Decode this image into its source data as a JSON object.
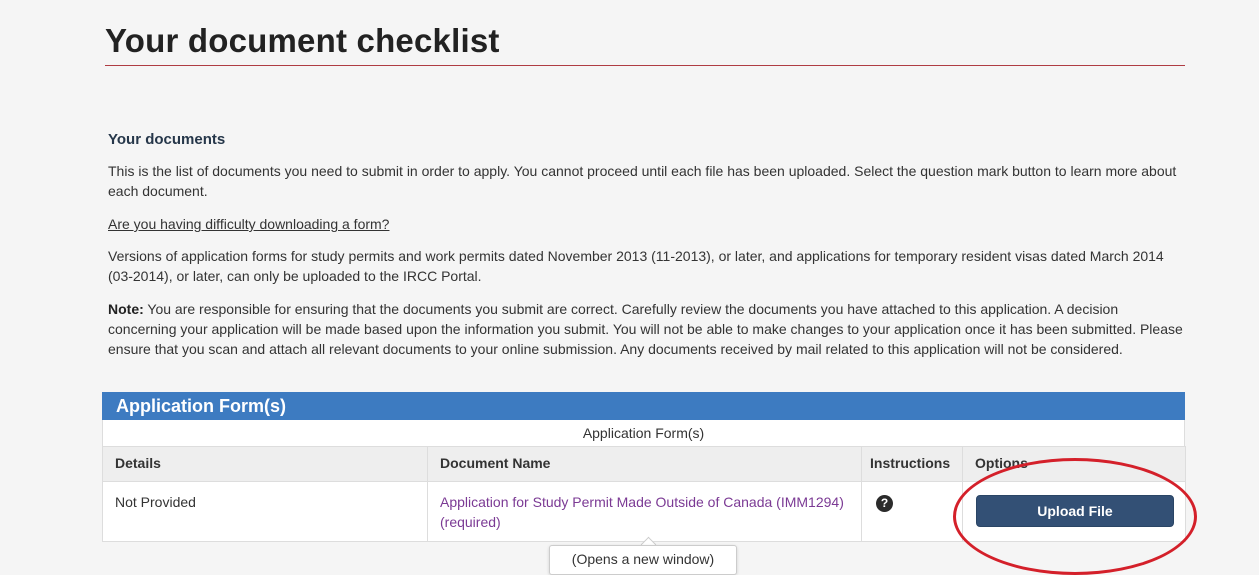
{
  "page": {
    "title": "Your document checklist"
  },
  "documents_section": {
    "heading": "Your documents",
    "intro": "This is the list of documents you need to submit in order to apply. You cannot proceed until each file has been uploaded. Select the question mark button to learn more about each document.",
    "help_link": "Are you having difficulty downloading a form?",
    "versions_note": "Versions of application forms for study permits and work permits dated November 2013 (11-2013), or later, and applications for temporary resident visas dated March 2014 (03-2014), or later, can only be uploaded to the IRCC Portal.",
    "note_label": "Note:",
    "note_text": " You are responsible for ensuring that the documents you submit are correct. Carefully review the documents you have attached to this application. A decision concerning your application will be made based upon the information you submit. You will not be able to make changes to your application once it has been submitted. Please ensure that you scan and attach all relevant documents to your online submission.  Any documents received by mail related to this application will not be considered."
  },
  "application_forms": {
    "panel_title": "Application Form(s)",
    "table_caption": "Application Form(s)",
    "columns": {
      "details": "Details",
      "document_name": "Document Name",
      "instructions": "Instructions",
      "options": "Options"
    },
    "rows": [
      {
        "details": "Not Provided",
        "document_name": "Application for Study Permit Made Outside of Canada (IMM1294)",
        "required_tag": "(required)",
        "instructions_icon": "question-mark-icon",
        "instructions_glyph": "?",
        "action_label": "Upload File"
      }
    ]
  },
  "tooltip": {
    "text": "(Opens a new window)"
  },
  "colors": {
    "panel_header": "#3d7bc1",
    "upload_button": "#335075",
    "title_rule": "#af3c43",
    "doc_link": "#7b3a94",
    "highlight_ellipse": "#d4202a"
  }
}
